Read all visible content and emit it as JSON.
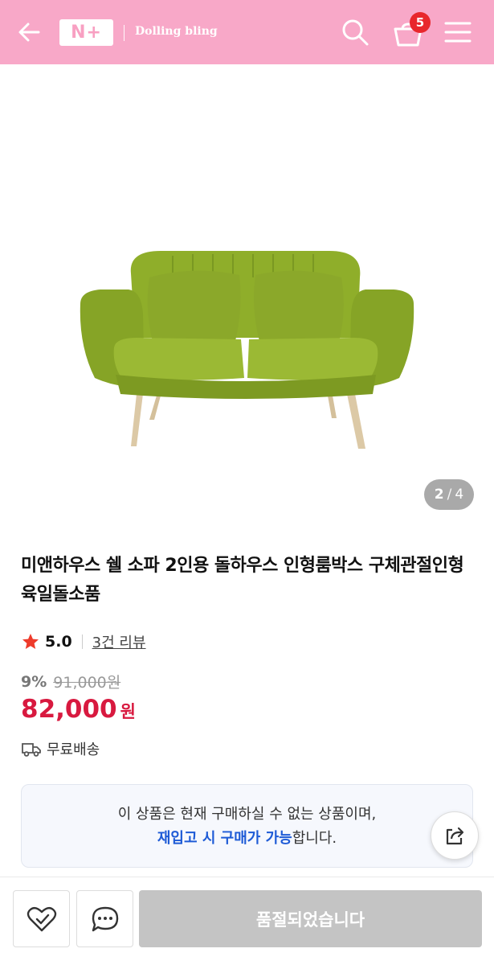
{
  "header": {
    "logo_text": "N+",
    "store_name": "Dolling bling",
    "cart_count": "5",
    "icons": [
      "back-arrow-icon",
      "search-icon",
      "cart-icon",
      "menu-icon"
    ],
    "background_color": "#f8a8c8"
  },
  "product": {
    "image_counter": {
      "current": "2",
      "separator": "/",
      "total": "4"
    },
    "title": "미앤하우스 쉘 소파 2인용 돌하우스 인형룸박스 구체관절인형 육일돌소품",
    "rating": "5.0",
    "review_link": "3건 리뷰",
    "discount": "9%",
    "original_price": "91,000원",
    "price": "82,000",
    "currency": "원",
    "shipping": "무료배송",
    "price_color": "#d8193f"
  },
  "notice": {
    "line1": "이 상품은 현재 구매하실 수 없는 상품이며,",
    "highlight": "재입고 시 구매가 가능",
    "suffix": "합니다."
  },
  "bottom_bar": {
    "soldout_label": "품절되었습니다"
  }
}
